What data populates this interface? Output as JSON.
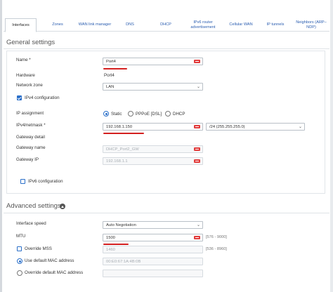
{
  "tabs": [
    {
      "label": "Interfaces",
      "active": true
    },
    {
      "label": "Zones"
    },
    {
      "label": "WAN link manager"
    },
    {
      "label": "DNS"
    },
    {
      "label": "DHCP"
    },
    {
      "label": "IPv6 router advertisement"
    },
    {
      "label": "Cellular WAN"
    },
    {
      "label": "IP tunnels"
    },
    {
      "label": "Neighbors (ARP–NDP)"
    }
  ],
  "general": {
    "title": "General settings",
    "name_label": "Name *",
    "name_value": "Port4",
    "hardware_label": "Hardware",
    "hardware_value": "Port4",
    "zone_label": "Network zone",
    "zone_value": "LAN",
    "ipv4_config_label": "IPv4 configuration",
    "ip_assignment_label": "IP assignment",
    "ip_assignment_options": [
      "Static",
      "PPPoE [DSL]",
      "DHCP"
    ],
    "ipv4_label": "IPv4/netmask *",
    "ipv4_value": "192.168.1.150",
    "netmask_value": "/24 (255.255.255.0)",
    "gateway_detail_label": "Gateway detail",
    "gateway_name_label": "Gateway name",
    "gateway_name_placeholder": "DHCP_Port2_GW",
    "gateway_ip_label": "Gateway IP",
    "gateway_ip_placeholder": "192.168.1.1",
    "ipv6_config_label": "IPv6 configuration"
  },
  "advanced": {
    "title": "Advanced settings",
    "interface_speed_label": "Interface speed",
    "interface_speed_value": "Auto Negotiation",
    "mtu_label": "MTU",
    "mtu_value": "1500",
    "mtu_range": "[576 - 9000]",
    "override_mss_label": "Override MSS",
    "mss_placeholder": "1460",
    "mss_range": "[536 - 8960]",
    "default_mac_label": "Use default MAC address",
    "default_mac_value": "00:E0:67:1A:4B:0B",
    "override_mac_label": "Override default MAC address"
  },
  "colors": {
    "accent": "#2a6fc9",
    "error": "#e23c3c",
    "annotation": "#d42020"
  }
}
